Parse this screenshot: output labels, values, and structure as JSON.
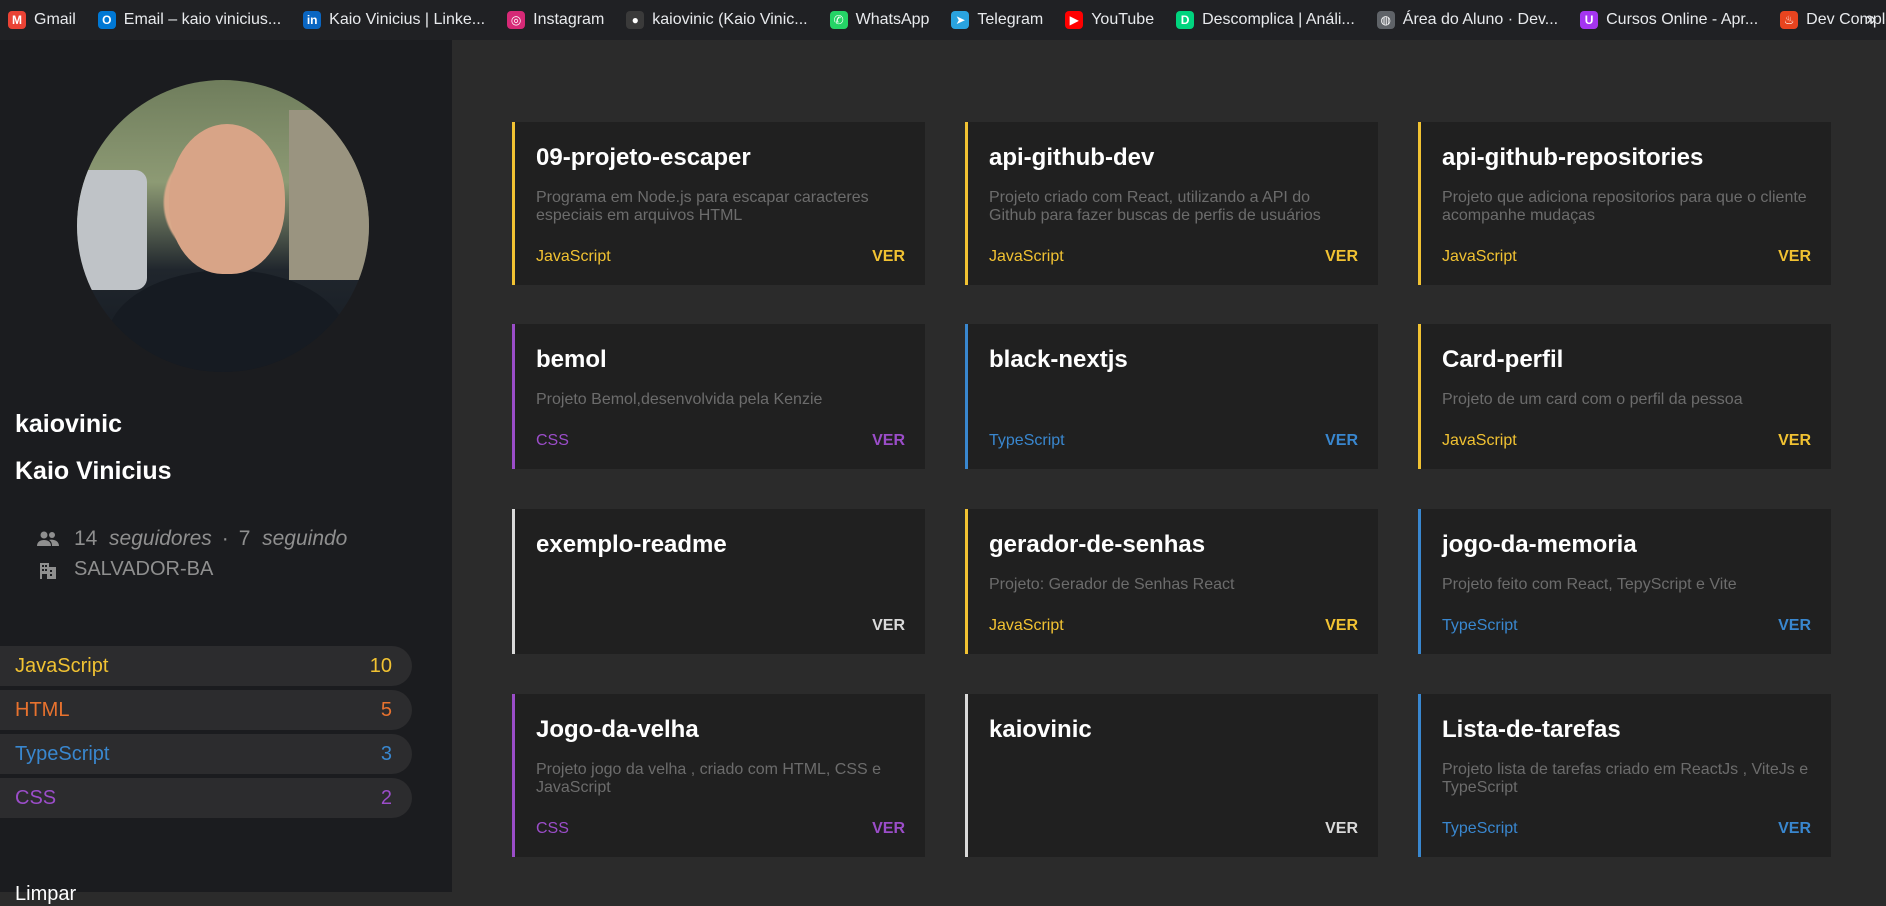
{
  "bookmarks": [
    {
      "label": "Gmail",
      "icon": "gmail-icon",
      "color": "#ea4335",
      "glyph": "M"
    },
    {
      "label": "Email – kaio vinicius...",
      "icon": "outlook-icon",
      "color": "#0078d4",
      "glyph": "O"
    },
    {
      "label": "Kaio Vinicius | Linke...",
      "icon": "linkedin-icon",
      "color": "#0a66c2",
      "glyph": "in"
    },
    {
      "label": "Instagram",
      "icon": "instagram-icon",
      "color": "#d62976",
      "glyph": "◎"
    },
    {
      "label": "kaiovinic (Kaio Vinic...",
      "icon": "github-icon",
      "color": "#3a3a3a",
      "glyph": "●"
    },
    {
      "label": "WhatsApp",
      "icon": "whatsapp-icon",
      "color": "#25d366",
      "glyph": "✆"
    },
    {
      "label": "Telegram",
      "icon": "telegram-icon",
      "color": "#2aa3df",
      "glyph": "➤"
    },
    {
      "label": "YouTube",
      "icon": "youtube-icon",
      "color": "#ff0000",
      "glyph": "▶"
    },
    {
      "label": "Descomplica | Análi...",
      "icon": "descomplica-icon",
      "color": "#00d47e",
      "glyph": "D"
    },
    {
      "label": "Área do Aluno · Dev...",
      "icon": "globe-icon",
      "color": "#5f6368",
      "glyph": "◍"
    },
    {
      "label": "Cursos Online - Apr...",
      "icon": "udemy-icon",
      "color": "#a435f0",
      "glyph": "U"
    },
    {
      "label": "Dev Completo",
      "icon": "flame-icon",
      "color": "#e8441f",
      "glyph": "♨"
    }
  ],
  "bookmarks_more": "»",
  "profile": {
    "login": "kaiovinic",
    "name": "Kaio Vinicius",
    "followers": "14",
    "followers_label": "seguidores",
    "separator": "·",
    "following": "7",
    "following_label": "seguindo",
    "location": "SALVADOR-BA"
  },
  "languages": [
    {
      "name": "JavaScript",
      "count": "10",
      "color": "#f1c232"
    },
    {
      "name": "HTML",
      "count": "5",
      "color": "#e8722e"
    },
    {
      "name": "TypeScript",
      "count": "3",
      "color": "#3987cf"
    },
    {
      "name": "CSS",
      "count": "2",
      "color": "#9b4dc9"
    }
  ],
  "clear_label": "Limpar",
  "repos": [
    {
      "title": "09-projeto-escaper",
      "desc": "Programa em Node.js para escapar caracteres especiais em arquivos HTML",
      "lang": "JavaScript",
      "color": "#f1c232",
      "action": "VER"
    },
    {
      "title": "api-github-dev",
      "desc": "Projeto criado com React, utilizando a API do Github para fazer buscas de perfis de usuários",
      "lang": "JavaScript",
      "color": "#f1c232",
      "action": "VER"
    },
    {
      "title": "api-github-repositories",
      "desc": "Projeto que adiciona repositorios para que o cliente acompanhe mudaças",
      "lang": "JavaScript",
      "color": "#f1c232",
      "action": "VER"
    },
    {
      "title": "bemol",
      "desc": "Projeto Bemol,desenvolvida pela Kenzie",
      "lang": "CSS",
      "color": "#9b4dc9",
      "action": "VER"
    },
    {
      "title": "black-nextjs",
      "desc": "",
      "lang": "TypeScript",
      "color": "#3987cf",
      "action": "VER"
    },
    {
      "title": "Card-perfil",
      "desc": "Projeto de um card com o perfil da pessoa",
      "lang": "JavaScript",
      "color": "#f1c232",
      "action": "VER"
    },
    {
      "title": "exemplo-readme",
      "desc": "",
      "lang": "",
      "color": "#d9d9d9",
      "action": "VER"
    },
    {
      "title": "gerador-de-senhas",
      "desc": "Projeto: Gerador de Senhas React",
      "lang": "JavaScript",
      "color": "#f1c232",
      "action": "VER"
    },
    {
      "title": "jogo-da-memoria",
      "desc": "Projeto feito com React, TepyScript e Vite",
      "lang": "TypeScript",
      "color": "#3987cf",
      "action": "VER"
    },
    {
      "title": "Jogo-da-velha",
      "desc": "Projeto jogo da velha , criado com HTML, CSS e JavaScript",
      "lang": "CSS",
      "color": "#9b4dc9",
      "action": "VER"
    },
    {
      "title": "kaiovinic",
      "desc": "",
      "lang": "",
      "color": "#d9d9d9",
      "action": "VER"
    },
    {
      "title": "Lista-de-tarefas",
      "desc": "Projeto lista de tarefas criado em ReactJs , ViteJs e TypeScript",
      "lang": "TypeScript",
      "color": "#3987cf",
      "action": "VER"
    }
  ]
}
